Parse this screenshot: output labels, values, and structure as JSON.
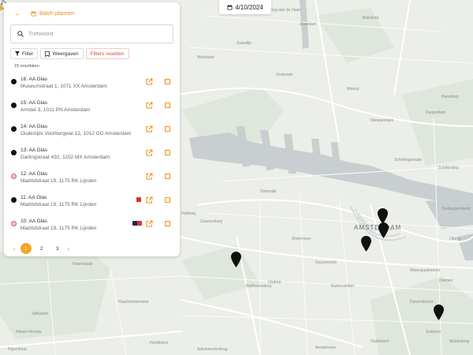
{
  "date_display": "4/10/2024",
  "panel": {
    "batch_label": "Batch plannen",
    "search_placeholder": "Trefwoord",
    "filter_label": "Filter",
    "views_label": "Weergaven",
    "reset_label": "Filters resetten",
    "result_count": "15 resultaten",
    "items": [
      {
        "title": "16: AA Glas",
        "address": "Museumstraat 1, 1071 XX Amsterdam",
        "marker": "black"
      },
      {
        "title": "15: AA Glas",
        "address": "Amstel 3, 1011 PN Amsterdam",
        "marker": "black"
      },
      {
        "title": "14: AA Glas",
        "address": "Oudezijds Voorburgwal 12, 1012 GD Amsterdam",
        "marker": "black"
      },
      {
        "title": "13: AA Glas",
        "address": "Darlingstraat 432, 1102 MX Amsterdam",
        "marker": "black"
      },
      {
        "title": "12: AA Glas",
        "address": "Madridstraat 19, 1175 RK Lijnden",
        "marker": "pink"
      },
      {
        "title": "11: AA Glas",
        "address": "Madridstraat 19, 1175 RK Lijnden",
        "marker": "black"
      },
      {
        "title": "10: AA Glas",
        "address": "Madridstraat 19, 1175 RK Lijnden",
        "marker": "pink"
      }
    ],
    "pages": [
      "1",
      "2",
      "3"
    ],
    "current_page": "1"
  },
  "map": {
    "city_label": "AMSTERDAM",
    "labels": [
      "Zaandam",
      "Oostzaan",
      "Westzaan",
      "Zaandijk",
      "Koog aan de Zaan",
      "Nieuwendam",
      "Durgerdam",
      "Zunderdorp",
      "Sloterdijk",
      "Zeeburgereiland",
      "Zwanenburg",
      "Halfweg",
      "Badhoevedorp",
      "Amstelveen",
      "Diemen",
      "Duivendrecht",
      "Ouderkerk",
      "Heemstede",
      "Haarlemmermeer",
      "Vijfhuizen",
      "Hoofddorp",
      "Nieuw-Vennep",
      "Osdorp",
      "Slotermeer",
      "Geuzenveld",
      "Buiksloot",
      "Ransdorp",
      "Schellingwoude",
      "IJburg",
      "Watergraafsmeer",
      "Buitenveldert",
      "Zuidoost",
      "Aalsmeerderbrug",
      "Rijsenhout",
      "Weesp",
      "Muiderberg"
    ],
    "accent": "#f08a1a"
  }
}
